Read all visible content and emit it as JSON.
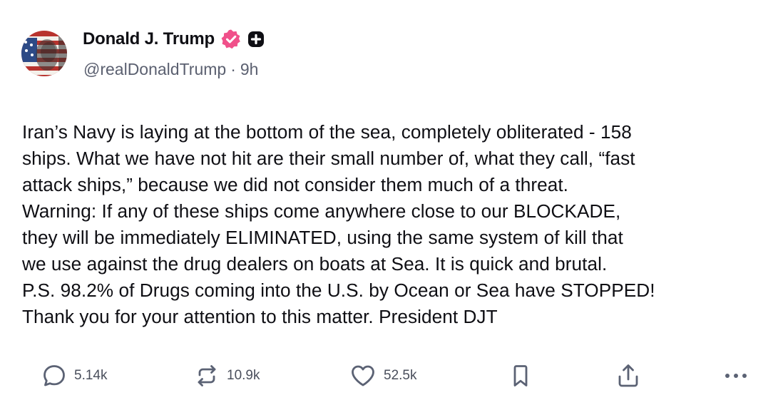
{
  "post": {
    "author": {
      "display_name": "Donald J. Trump",
      "handle": "@realDonaldTrump",
      "separator": "·",
      "time": "9h",
      "verified_icon": "verified-badge-icon",
      "extra_badge_icon": "plus-badge-icon"
    },
    "text": "Iran’s Navy is laying at the bottom of the sea, completely obliterated - 158\nships. What we have not hit are their small number of, what they call, “fast\nattack ships,” because we did not consider them much of a threat.\nWarning: If any of these ships come anywhere close to our BLOCKADE,\nthey will be immediately ELIMINATED, using the same system of kill that\nwe use against the drug dealers on boats at Sea. It is quick and brutal.\nP.S. 98.2% of Drugs coming into the U.S. by Ocean or Sea have STOPPED!\nThank you for your attention to this matter. President DJT",
    "actions": {
      "replies": "5.14k",
      "reposts": "10.9k",
      "likes": "52.5k"
    }
  },
  "colors": {
    "text": "#0f0f14",
    "muted": "#5b6070",
    "verified_badge": "#f0508a",
    "plus_badge": "#0f0f14",
    "icon": "#5b6274"
  }
}
